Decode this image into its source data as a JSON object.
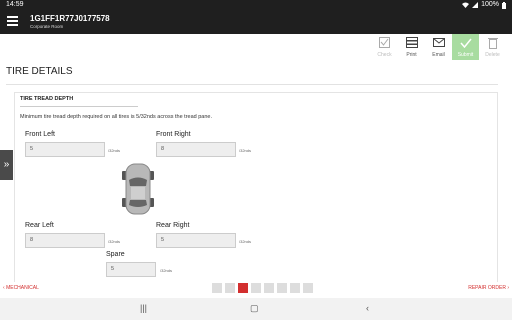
{
  "status": {
    "time": "14:59",
    "battery": "100%",
    "signal_icons": [
      "photo-icon",
      "mail-icon",
      "wifi-icon",
      "signal-icon",
      "battery-icon"
    ]
  },
  "header": {
    "vin": "1G1FF1R77J0177578",
    "subtitle": "Corporate Room"
  },
  "toolbar": {
    "check": "Check",
    "print": "Print",
    "email": "Email",
    "submit": "Submit",
    "delete": "Delete"
  },
  "page": {
    "title": "TIRE DETAILS"
  },
  "section": {
    "title": "TIRE TREAD DEPTH",
    "instruction": "Minimum tire tread depth required on all tires is 5/32nds across the tread pane."
  },
  "tires": {
    "front_left": {
      "label": "Front Left",
      "value": "5",
      "unit": "/32nds"
    },
    "front_right": {
      "label": "Front Right",
      "value": "8",
      "unit": "/32nds"
    },
    "rear_left": {
      "label": "Rear Left",
      "value": "8",
      "unit": "/32nds"
    },
    "rear_right": {
      "label": "Rear Right",
      "value": "5",
      "unit": "/32nds"
    },
    "spare": {
      "label": "Spare",
      "value": "5",
      "unit": "/32nds"
    }
  },
  "footer": {
    "prev": "MECHANICAL",
    "next": "REPAIR ORDER",
    "steps_total": 8,
    "steps_active": 3
  },
  "colors": {
    "accent": "#d32f2f",
    "appbar": "#1f1f1f",
    "submit": "#a8dca0"
  }
}
